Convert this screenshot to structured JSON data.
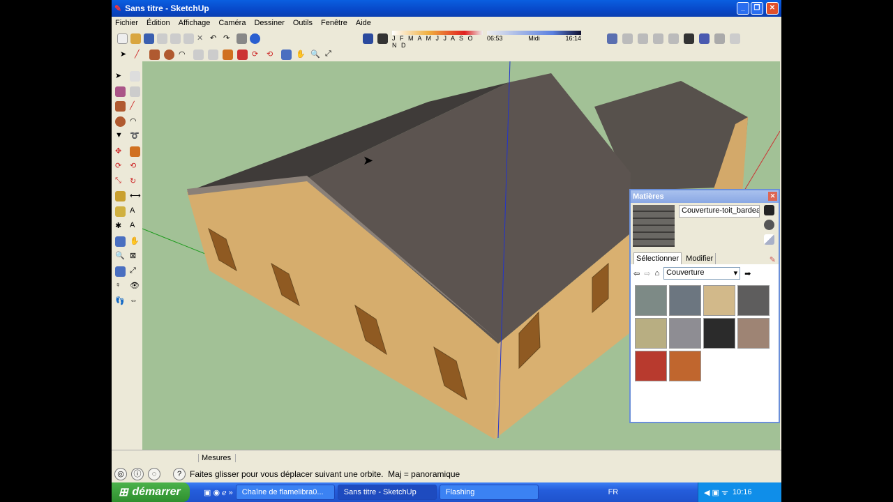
{
  "window": {
    "title": "Sans titre - SketchUp"
  },
  "menu": [
    "Fichier",
    "Édition",
    "Affichage",
    "Caméra",
    "Dessiner",
    "Outils",
    "Fenêtre",
    "Aide"
  ],
  "shadow_toolbar": {
    "months": "J F M A M J J A S O N D",
    "time_start": "06:53",
    "time_mid": "Midi",
    "time_end": "16:14"
  },
  "measures_label": "Mesures",
  "status_text": "Faites glisser pour vous déplacer suivant une orbite.  Maj = panoramique",
  "materials_panel": {
    "title": "Matières",
    "material_name": "Couverture-toit_bardea",
    "tabs": [
      "Sélectionner",
      "Modifier"
    ],
    "active_tab": "Sélectionner",
    "library": "Couverture",
    "swatches": [
      "#7d8a86",
      "#6c7680",
      "#d2b98a",
      "#5e5d5d",
      "#b8ae82",
      "#8e8d93",
      "#2b2b2b",
      "#9e8474",
      "#b83a2e",
      "#c0662e"
    ]
  },
  "taskbar": {
    "start": "démarrer",
    "tasks": [
      "Chaîne de flamelibra0...",
      "Sans titre - SketchUp",
      "Flashing"
    ],
    "active_task": "Sans titre - SketchUp",
    "lang": "FR",
    "clock": "10:16"
  },
  "colors": {
    "viewport_bg": "#a2c196",
    "roof": "#5a5450",
    "wall": "#d6ad6d",
    "titlebar": "#0a5fe0"
  }
}
